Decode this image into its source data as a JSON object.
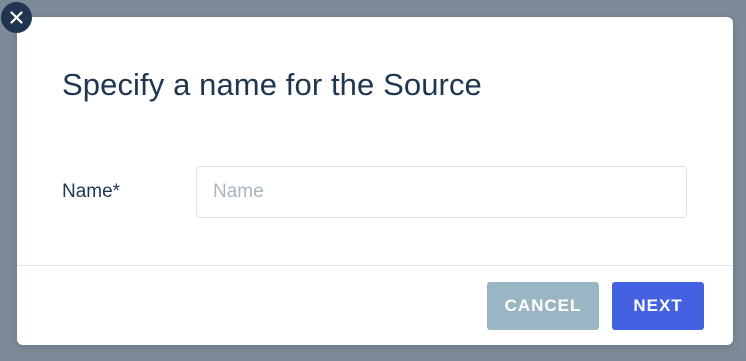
{
  "dialog": {
    "title": "Specify a name for the Source",
    "close_icon": "close-icon"
  },
  "form": {
    "name_label": "Name*",
    "name_value": "",
    "name_placeholder": "Name"
  },
  "footer": {
    "cancel_label": "CANCEL",
    "next_label": "NEXT"
  },
  "colors": {
    "backdrop": "#7d8a97",
    "title_text": "#1f3550",
    "close_button": "#1f3550",
    "cancel_button": "#9ab6c5",
    "next_button": "#4361e0"
  }
}
